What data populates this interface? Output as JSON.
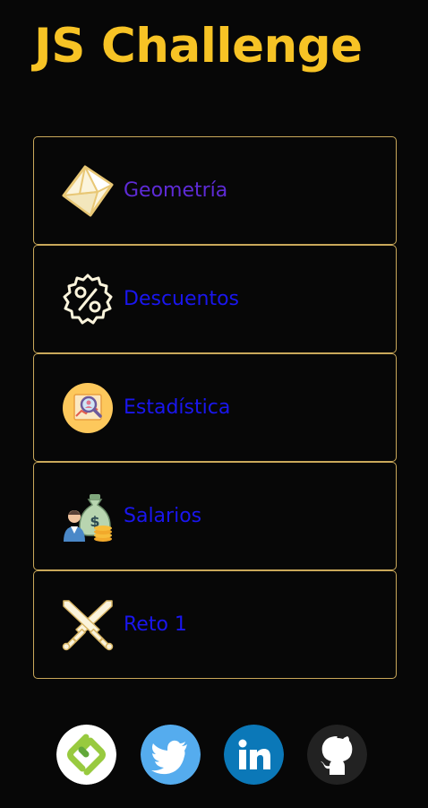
{
  "app": {
    "title": "JS Challenge",
    "accent_color": "#f7c325",
    "card_border_color": "#c9a85a"
  },
  "menu": {
    "items": [
      {
        "label": "Geometría",
        "icon": "geometry-icon",
        "color": "#5e2bd6"
      },
      {
        "label": "Descuentos",
        "icon": "discount-icon",
        "color": "#1a16ee"
      },
      {
        "label": "Estadística",
        "icon": "statistics-icon",
        "color": "#1a16ee"
      },
      {
        "label": "Salarios",
        "icon": "salary-icon",
        "color": "#1a16ee"
      },
      {
        "label": "Reto 1",
        "icon": "crossed-swords-icon",
        "color": "#1a16ee"
      }
    ]
  },
  "social": {
    "links": [
      {
        "icon": "platzi-icon",
        "color": "#98ca3f"
      },
      {
        "icon": "twitter-icon",
        "color": "#55acee"
      },
      {
        "icon": "linkedin-icon",
        "color": "#0b78b8"
      },
      {
        "icon": "github-icon",
        "color": "#222222"
      }
    ]
  }
}
